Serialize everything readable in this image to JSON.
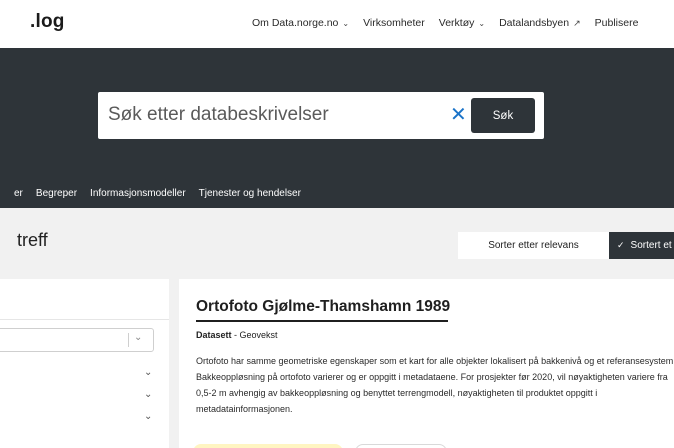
{
  "header": {
    "brand": " ˝log",
    "nav": [
      {
        "label": "Om Data.norge.no",
        "icon": "chevron-down-icon"
      },
      {
        "label": "Virksomheter",
        "icon": null
      },
      {
        "label": "Verktøy",
        "icon": "chevron-down-icon"
      },
      {
        "label": "Datalandsbyen",
        "icon": "external-link-icon"
      },
      {
        "label": "Publisere",
        "icon": null
      }
    ]
  },
  "search": {
    "placeholder": "Søk etter databeskrivelser",
    "button_label": "Søk",
    "clear_icon": "close-icon"
  },
  "tabs": [
    "er",
    "Begreper",
    "Informasjonsmodeller",
    "Tjenester og hendelser"
  ],
  "results": {
    "count_label": "treff",
    "sort_relevance": "Sorter etter relevans",
    "sort_date": "Sortert et"
  },
  "result": {
    "title": "Ortofoto Gjølme-Thamshamn 1989",
    "type": "Datasett",
    "publisher": " - Geovekst",
    "description": "Ortofoto har samme geometriske egenskaper som et kart for alle objekter lokalisert på bakkenivå og et referansesystem. Bakkeoppløsning på ortofoto varierer og er oppgitt i metadataene. For prosjekter før 2020, vil nøyaktigheten variere fra 0,5-2 m avhengig av bakkeoppløsning og benyttet terrengmodell, nøyaktigheten til produktet oppgitt i metadatainformasjonen."
  },
  "colors": {
    "hero_bg": "#2e3439",
    "accent": "#1a73c8",
    "chip_yellow": "#fff5c2"
  }
}
